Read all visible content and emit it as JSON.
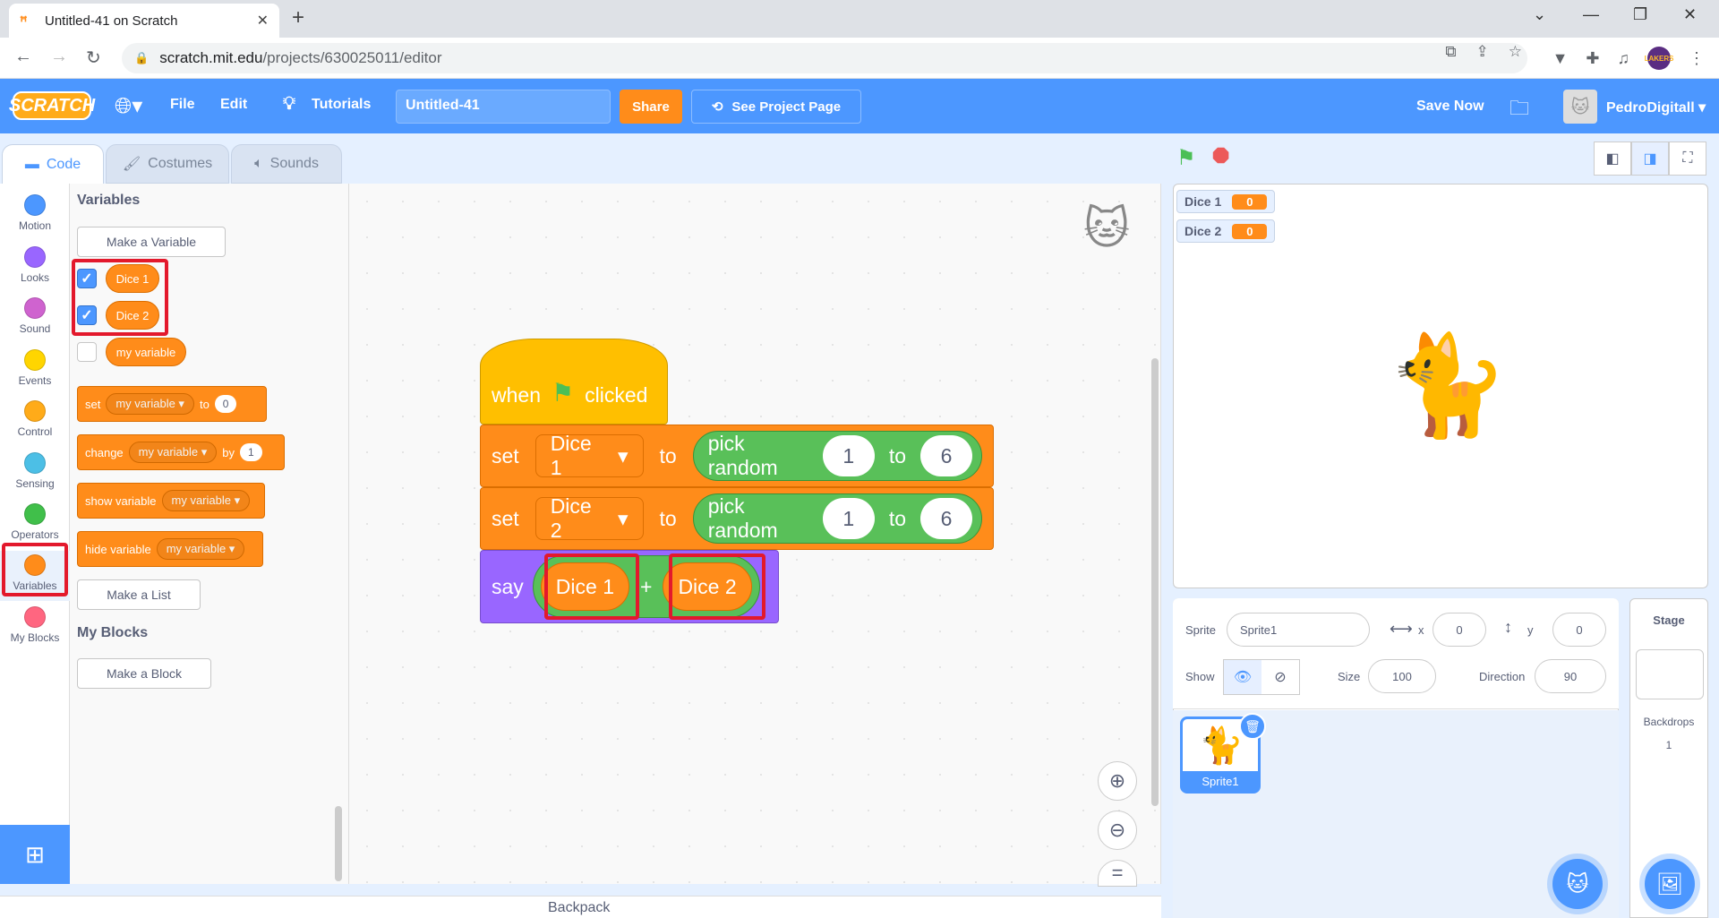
{
  "browser": {
    "tab_title": "Untitled-41 on Scratch",
    "url_host": "scratch.mit.edu",
    "url_path": "/projects/630025011/editor"
  },
  "menubar": {
    "logo": "SCRATCH",
    "file": "File",
    "edit": "Edit",
    "tutorials": "Tutorials",
    "project_title": "Untitled-41",
    "share": "Share",
    "see_project_page": "See Project Page",
    "save_now": "Save Now",
    "username": "PedroDigitall"
  },
  "tabs": {
    "code": "Code",
    "costumes": "Costumes",
    "sounds": "Sounds"
  },
  "categories": [
    {
      "label": "Motion",
      "color": "#4c97ff"
    },
    {
      "label": "Looks",
      "color": "#9966ff"
    },
    {
      "label": "Sound",
      "color": "#cf63cf"
    },
    {
      "label": "Events",
      "color": "#ffd500"
    },
    {
      "label": "Control",
      "color": "#ffab19"
    },
    {
      "label": "Sensing",
      "color": "#4cbfe6"
    },
    {
      "label": "Operators",
      "color": "#40bf4a"
    },
    {
      "label": "Variables",
      "color": "#ff8c1a"
    },
    {
      "label": "My Blocks",
      "color": "#ff6680"
    }
  ],
  "palette": {
    "variables_heading": "Variables",
    "make_variable": "Make a Variable",
    "vars": [
      "Dice 1",
      "Dice 2",
      "my variable"
    ],
    "set_block": {
      "label": "set",
      "var": "my variable",
      "to": "to",
      "value": "0"
    },
    "change_block": {
      "label": "change",
      "var": "my variable",
      "by": "by",
      "value": "1"
    },
    "show_block": {
      "label": "show variable",
      "var": "my variable"
    },
    "hide_block": {
      "label": "hide variable",
      "var": "my variable"
    },
    "make_list": "Make a List",
    "myblocks_heading": "My Blocks",
    "make_block": "Make a Block"
  },
  "script": {
    "hat_when": "when",
    "hat_clicked": "clicked",
    "set1": {
      "label": "set",
      "var": "Dice 1",
      "to": "to",
      "op": "pick random",
      "from": "1",
      "op_to": "to",
      "max": "6"
    },
    "set2": {
      "label": "set",
      "var": "Dice 2",
      "to": "to",
      "op": "pick random",
      "from": "1",
      "op_to": "to",
      "max": "6"
    },
    "say": {
      "label": "say",
      "left": "Dice 1",
      "plus": "+",
      "right": "Dice 2"
    }
  },
  "backpack": "Backpack",
  "monitors": [
    {
      "name": "Dice 1",
      "value": "0"
    },
    {
      "name": "Dice 2",
      "value": "0"
    }
  ],
  "sprite_info": {
    "sprite_label": "Sprite",
    "sprite_name": "Sprite1",
    "x_label": "x",
    "x": "0",
    "y_label": "y",
    "y": "0",
    "show_label": "Show",
    "size_label": "Size",
    "size": "100",
    "direction_label": "Direction",
    "direction": "90"
  },
  "sprite_tile": "Sprite1",
  "stage_pane": {
    "heading": "Stage",
    "backdrops_label": "Backdrops",
    "backdrops_count": "1"
  }
}
